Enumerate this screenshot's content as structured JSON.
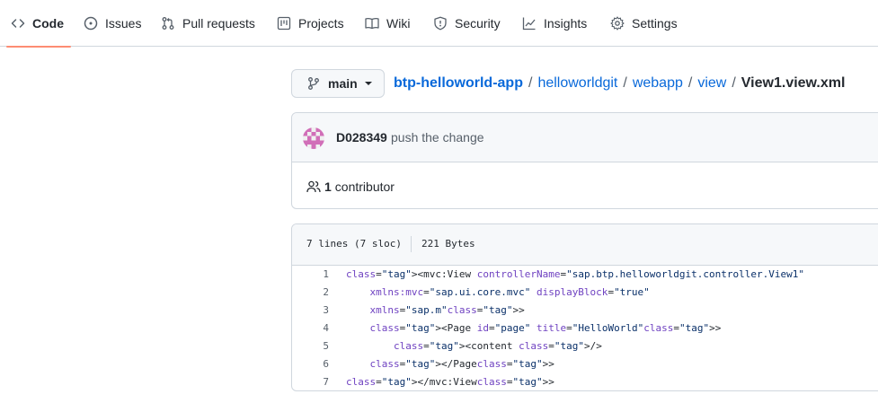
{
  "nav": {
    "tabs": [
      {
        "label": "Code",
        "icon": "code-icon",
        "active": true
      },
      {
        "label": "Issues",
        "icon": "issue-opened-icon"
      },
      {
        "label": "Pull requests",
        "icon": "git-pull-request-icon"
      },
      {
        "label": "Projects",
        "icon": "project-icon"
      },
      {
        "label": "Wiki",
        "icon": "book-icon"
      },
      {
        "label": "Security",
        "icon": "shield-icon"
      },
      {
        "label": "Insights",
        "icon": "graph-icon"
      },
      {
        "label": "Settings",
        "icon": "gear-icon"
      }
    ],
    "active_underline_color": "#fd8c73"
  },
  "branch": {
    "name": "main",
    "icon": "git-branch-icon"
  },
  "breadcrumb": {
    "repo": "btp-helloworld-app",
    "parts": [
      "helloworldgit",
      "webapp",
      "view"
    ],
    "separator": "/",
    "file": "View1.view.xml"
  },
  "commit": {
    "author": "D028349",
    "message": "push the change",
    "avatar": "identicon-avatar"
  },
  "contributors": {
    "count": "1",
    "label": "contributor",
    "icon": "people-icon"
  },
  "file": {
    "lines_info": "7 lines (7 sloc)",
    "size": "221 Bytes",
    "code_lines": [
      {
        "num": "1",
        "text": "<mvc:View controllerName=\"sap.btp.helloworldgit.controller.View1\""
      },
      {
        "num": "2",
        "text": "    xmlns:mvc=\"sap.ui.core.mvc\" displayBlock=\"true\""
      },
      {
        "num": "3",
        "text": "    xmlns=\"sap.m\">"
      },
      {
        "num": "4",
        "text": "    <Page id=\"page\" title=\"HelloWorld\">"
      },
      {
        "num": "5",
        "text": "        <content />"
      },
      {
        "num": "6",
        "text": "    </Page>"
      },
      {
        "num": "7",
        "text": "</mvc:View>"
      }
    ]
  },
  "colors": {
    "link": "#0969da",
    "border": "#d0d7de",
    "muted": "#57606a"
  }
}
